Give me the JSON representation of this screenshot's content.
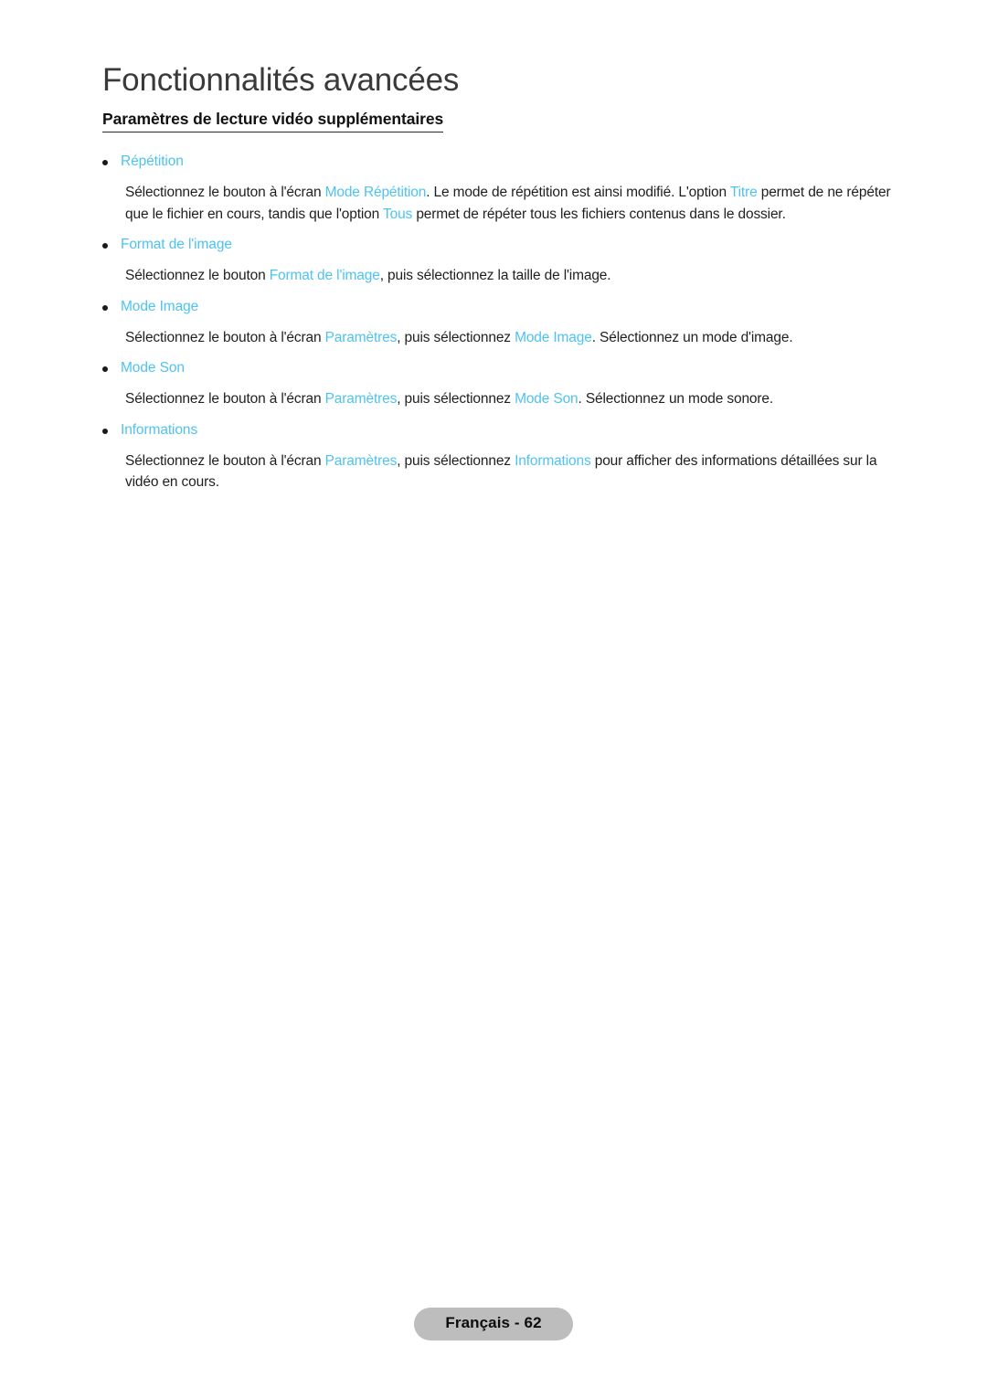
{
  "document": {
    "title": "Fonctionnalités avancées",
    "subtitle": "Paramètres de lecture vidéo supplémentaires",
    "accent_color": "#4EC3F0",
    "text_color": "#1F1F1F",
    "title_color": "#3A3A3A",
    "background_color": "#FFFFFF"
  },
  "sections": [
    {
      "label": "Répétition",
      "paragraph": {
        "p1": "Sélectionnez le bouton à l'écran ",
        "t1": "Mode Répétition",
        "p2": ". Le mode de répétition est ainsi modifié. L'option ",
        "t2": "Titre",
        "p3": " permet de ne répéter que le fichier en cours, tandis que l'option ",
        "t3": "Tous",
        "p4": " permet de répéter tous les fichiers contenus dans le dossier."
      }
    },
    {
      "label": "Format de l'image",
      "paragraph": {
        "p1": "Sélectionnez le bouton ",
        "t1": "Format de l'image",
        "p2": ", puis sélectionnez la taille de l'image."
      }
    },
    {
      "label": "Mode Image",
      "paragraph": {
        "p1": "Sélectionnez le bouton à l'écran ",
        "t1": "Paramètres",
        "p2": ", puis sélectionnez ",
        "t2": "Mode Image",
        "p3": ". Sélectionnez un mode d'image."
      }
    },
    {
      "label": "Mode Son",
      "paragraph": {
        "p1": "Sélectionnez le bouton à l'écran ",
        "t1": "Paramètres",
        "p2": ", puis sélectionnez ",
        "t2": "Mode Son",
        "p3": ". Sélectionnez un mode sonore."
      }
    },
    {
      "label": "Informations",
      "paragraph": {
        "p1": "Sélectionnez le bouton à l'écran ",
        "t1": "Paramètres",
        "p2": ", puis sélectionnez ",
        "t2": "Informations",
        "p3": " pour afficher des informations détaillées sur la vidéo en cours."
      }
    }
  ],
  "footer": {
    "page_badge": "Français - 62",
    "badge_color": "#BDBDBD"
  }
}
